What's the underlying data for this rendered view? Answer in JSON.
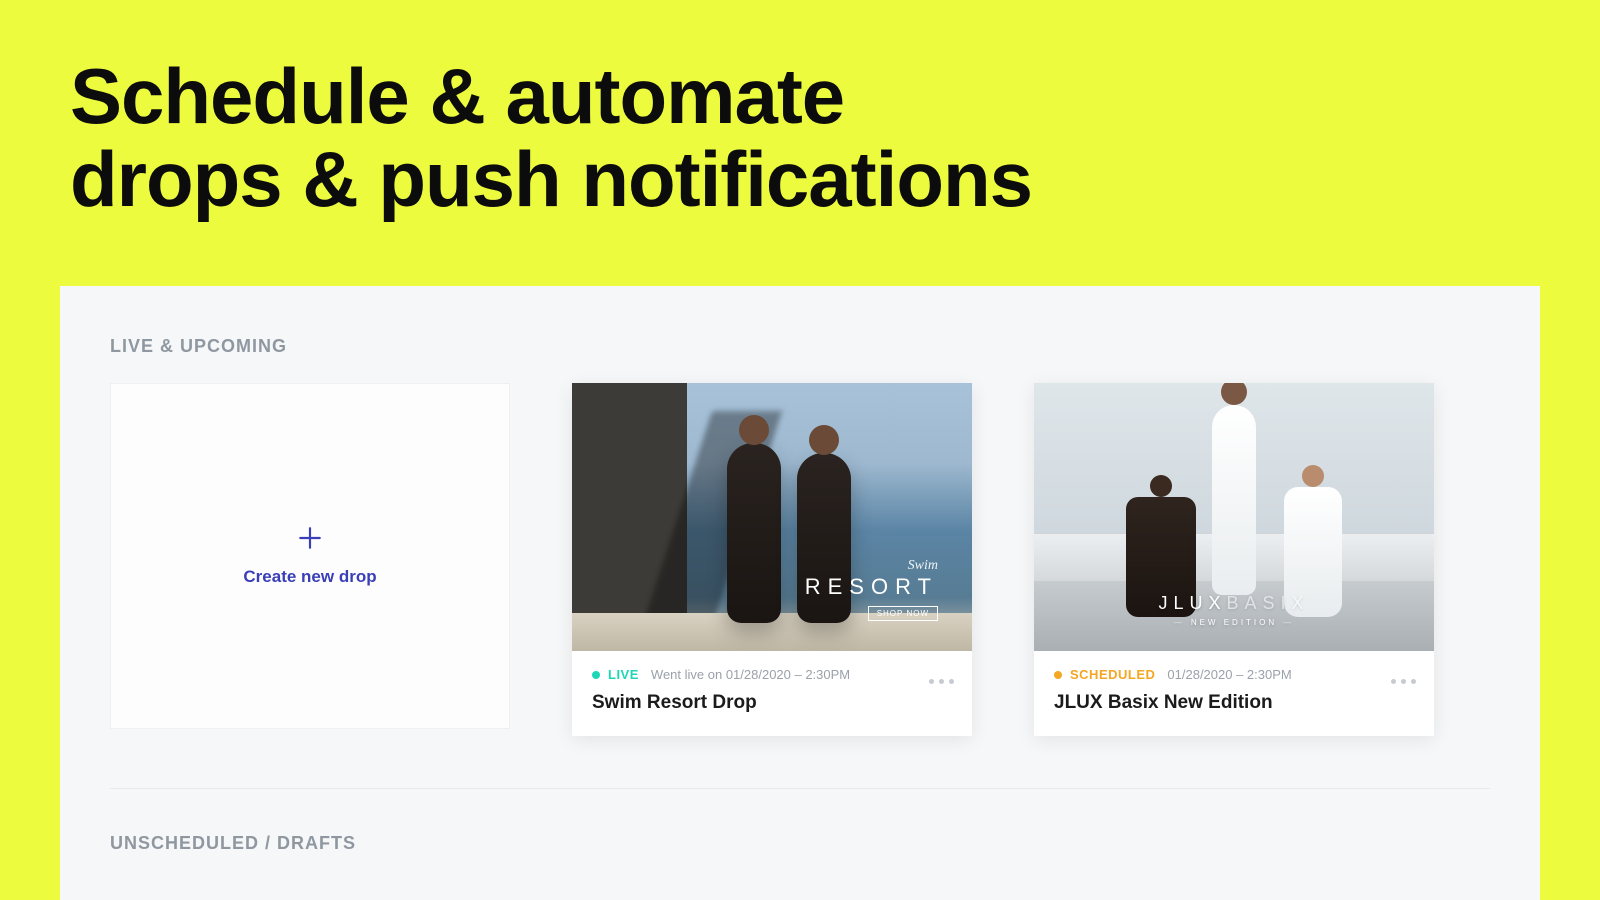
{
  "headline_line1": "Schedule & automate",
  "headline_line2": "drops & push notifications",
  "sections": {
    "live_upcoming_label": "LIVE & UPCOMING",
    "drafts_label": "UNSCHEDULED / DRAFTS"
  },
  "create_card": {
    "label": "Create new drop"
  },
  "drops": [
    {
      "status_label": "LIVE",
      "status_kind": "live",
      "date_text": "Went live on 01/28/2020 – 2:30PM",
      "title": "Swim Resort Drop",
      "image_overlay": {
        "script": "Swim",
        "main": "RESORT",
        "cta": "SHOP NOW"
      }
    },
    {
      "status_label": "SCHEDULED",
      "status_kind": "scheduled",
      "date_text": "01/28/2020 – 2:30PM",
      "title": "JLUX Basix New Edition",
      "image_overlay": {
        "brand_a": "JLUX",
        "brand_b": "BASIX",
        "sub": "NEW EDITION"
      }
    }
  ]
}
